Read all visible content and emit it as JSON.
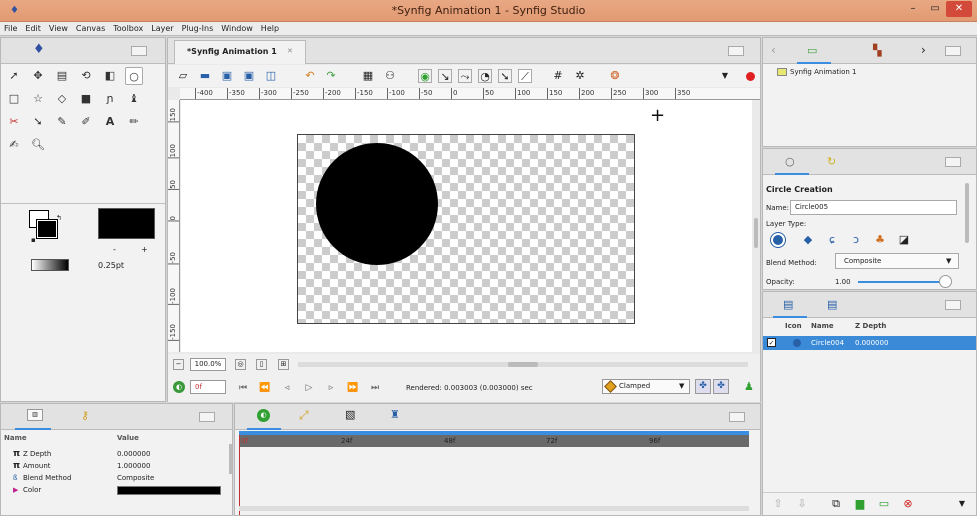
{
  "window": {
    "title": "*Synfig Animation 1 - Synfig Studio",
    "minimize": "–",
    "maximize": "▭",
    "close": "✕"
  },
  "menu": [
    "File",
    "Edit",
    "View",
    "Canvas",
    "Toolbox",
    "Layer",
    "Plug-Ins",
    "Window",
    "Help"
  ],
  "tab": {
    "label": "*Synfig Animation 1",
    "close": "✕"
  },
  "toolbox": {
    "width_label": "0.25pt",
    "minus": "-",
    "plus": "+"
  },
  "ruler_h": [
    "-400",
    "-350",
    "-300",
    "-250",
    "-200",
    "-150",
    "-100",
    "-50",
    "0",
    "50",
    "100",
    "150",
    "200",
    "250",
    "300",
    "350"
  ],
  "ruler_v": [
    "150",
    "100",
    "50",
    "0",
    "-50",
    "-100",
    "-150"
  ],
  "canvas_bottom": {
    "zoom": "100.0%",
    "frame": "0f",
    "rendered": "Rendered: 0.003003 (0.003000) sec",
    "interp": "Clamped"
  },
  "canvases": {
    "item": "Synfig Animation 1"
  },
  "tool_options": {
    "title": "Circle Creation",
    "name_label": "Name:",
    "name_value": "Circle005",
    "layer_type_label": "Layer Type:",
    "blend_label": "Blend Method:",
    "blend_value": "Composite",
    "opacity_label": "Opacity:",
    "opacity_value": "1.00"
  },
  "layers": {
    "headers": [
      "Icon",
      "Name",
      "Z Depth"
    ],
    "rows": [
      {
        "name": "Circle004",
        "z": "0.000000"
      }
    ]
  },
  "params": {
    "headers": [
      "Name",
      "Value"
    ],
    "rows": [
      {
        "name": "Z Depth",
        "value": "0.000000"
      },
      {
        "name": "Amount",
        "value": "1.000000"
      },
      {
        "name": "Blend Method",
        "value": "Composite"
      },
      {
        "name": "Color",
        "value": ""
      }
    ]
  },
  "timeline": {
    "marks": [
      "0f",
      "24f",
      "48f",
      "72f",
      "96f"
    ]
  },
  "colors": {
    "titlebar": "#e19a72",
    "selection": "#3a8ad8",
    "accent": "#3b8de0"
  }
}
